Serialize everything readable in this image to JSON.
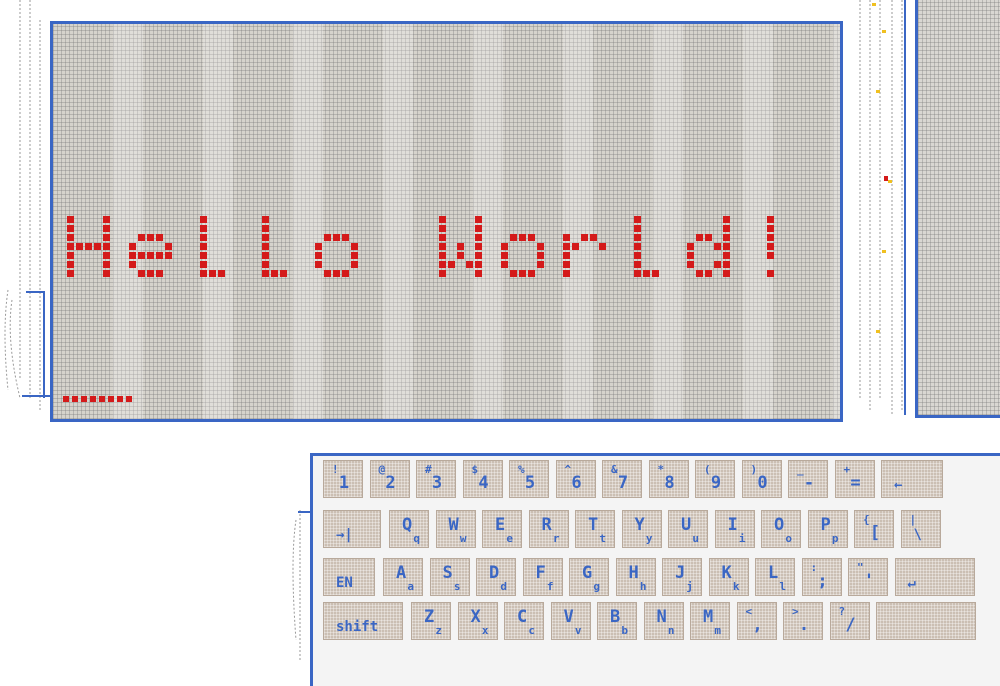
{
  "display": {
    "message": "Hello World!",
    "text_color": "#d41a1a",
    "frame_color": "#3a66c4"
  },
  "keyboard": {
    "key_color": "#cbbfb3",
    "label_color": "#3a66c4",
    "rows": [
      [
        {
          "main": "1",
          "sub": "!"
        },
        {
          "main": "2",
          "sub": "@"
        },
        {
          "main": "3",
          "sub": "#"
        },
        {
          "main": "4",
          "sub": "$"
        },
        {
          "main": "5",
          "sub": "%"
        },
        {
          "main": "6",
          "sub": "^"
        },
        {
          "main": "7",
          "sub": "&"
        },
        {
          "main": "8",
          "sub": "*"
        },
        {
          "main": "9",
          "sub": "("
        },
        {
          "main": "0",
          "sub": ")"
        },
        {
          "main": "-",
          "sub": "_"
        },
        {
          "main": "=",
          "sub": "+"
        },
        {
          "main": "←",
          "sub": ""
        }
      ],
      [
        {
          "main": "→|",
          "sub": ""
        },
        {
          "main": "Q",
          "sub": "q"
        },
        {
          "main": "W",
          "sub": "w"
        },
        {
          "main": "E",
          "sub": "e"
        },
        {
          "main": "R",
          "sub": "r"
        },
        {
          "main": "T",
          "sub": "t"
        },
        {
          "main": "Y",
          "sub": "y"
        },
        {
          "main": "U",
          "sub": "u"
        },
        {
          "main": "I",
          "sub": "i"
        },
        {
          "main": "O",
          "sub": "o"
        },
        {
          "main": "P",
          "sub": "p"
        },
        {
          "main": "[",
          "sub": "{"
        },
        {
          "main": "\\",
          "sub": "|"
        }
      ],
      [
        {
          "main": "EN",
          "sub": ""
        },
        {
          "main": "A",
          "sub": "a"
        },
        {
          "main": "S",
          "sub": "s"
        },
        {
          "main": "D",
          "sub": "d"
        },
        {
          "main": "F",
          "sub": "f"
        },
        {
          "main": "G",
          "sub": "g"
        },
        {
          "main": "H",
          "sub": "h"
        },
        {
          "main": "J",
          "sub": "j"
        },
        {
          "main": "K",
          "sub": "k"
        },
        {
          "main": "L",
          "sub": "l"
        },
        {
          "main": ";",
          "sub": ":"
        },
        {
          "main": "'",
          "sub": "\""
        },
        {
          "main": "↵",
          "sub": ""
        }
      ],
      [
        {
          "main": "shift",
          "sub": ""
        },
        {
          "main": "Z",
          "sub": "z"
        },
        {
          "main": "X",
          "sub": "x"
        },
        {
          "main": "C",
          "sub": "c"
        },
        {
          "main": "V",
          "sub": "v"
        },
        {
          "main": "B",
          "sub": "b"
        },
        {
          "main": "N",
          "sub": "n"
        },
        {
          "main": "M",
          "sub": "m"
        },
        {
          "main": ",",
          "sub": "<"
        },
        {
          "main": ".",
          "sub": ">"
        },
        {
          "main": "/",
          "sub": "?"
        },
        {
          "main": "",
          "sub": ""
        }
      ]
    ]
  }
}
